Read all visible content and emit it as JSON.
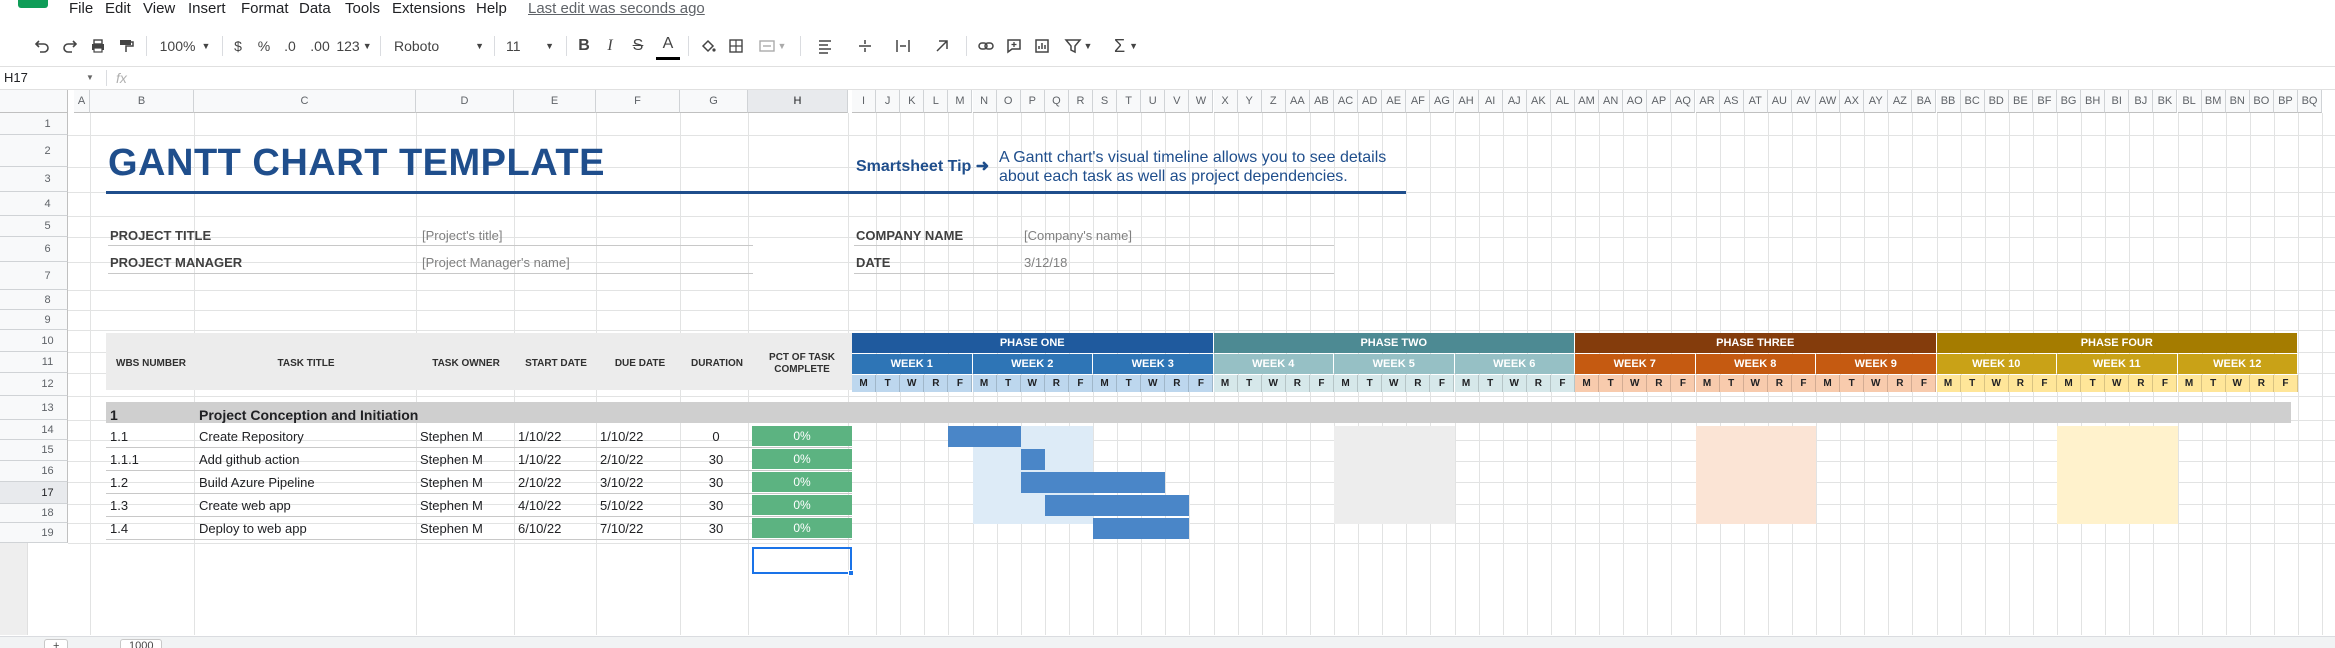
{
  "menu": {
    "items": [
      "File",
      "Edit",
      "View",
      "Insert",
      "Format",
      "Data",
      "Tools",
      "Extensions",
      "Help"
    ],
    "last_edit": "Last edit was seconds ago"
  },
  "toolbar": {
    "zoom": "100%",
    "currency": "$",
    "percent": "%",
    "decrease_decimal": ".0",
    "increase_decimal": ".00",
    "more_formats": "123",
    "font": "Roboto",
    "font_size": "11",
    "bold": "B",
    "italic": "I",
    "strike": "S",
    "text_color": "A"
  },
  "formula_bar": {
    "cell_ref": "H17",
    "fx": "fx",
    "value": ""
  },
  "columns": [
    "A",
    "B",
    "C",
    "D",
    "E",
    "F",
    "G",
    "H",
    "I",
    "J",
    "K",
    "L",
    "M",
    "N",
    "O",
    "P",
    "Q",
    "R",
    "S",
    "T",
    "U",
    "V",
    "W",
    "X",
    "Y",
    "Z",
    "AA",
    "AB",
    "AC",
    "AD",
    "AE",
    "AF",
    "AG",
    "AH",
    "AI",
    "AJ",
    "AK",
    "AL",
    "AM",
    "AN",
    "AO",
    "AP",
    "AQ",
    "AR",
    "AS",
    "AT",
    "AU",
    "AV",
    "AW",
    "AX",
    "AY",
    "AZ",
    "BA",
    "BB",
    "BC",
    "BD",
    "BE",
    "BF",
    "BG",
    "BH",
    "BI",
    "BJ",
    "BK",
    "BL",
    "BM",
    "BN",
    "BO",
    "BP",
    "BQ"
  ],
  "rows": [
    "1",
    "2",
    "3",
    "4",
    "5",
    "6",
    "7",
    "8",
    "9",
    "10",
    "11",
    "12",
    "13",
    "14",
    "15",
    "16",
    "17",
    "18",
    "19"
  ],
  "sheet": {
    "title": "GANTT CHART TEMPLATE",
    "tip_label": "Smartsheet Tip ➜",
    "tip_text": "A Gantt chart's visual timeline allows you to see details about each task as well as project dependencies.",
    "project_title_label": "PROJECT TITLE",
    "project_title_value": "[Project's title]",
    "project_manager_label": "PROJECT MANAGER",
    "project_manager_value": "[Project Manager's name]",
    "company_name_label": "COMPANY NAME",
    "company_name_value": "[Company's name]",
    "date_label": "DATE",
    "date_value": "3/12/18",
    "headers": {
      "wbs": "WBS NUMBER",
      "task": "TASK TITLE",
      "owner": "TASK OWNER",
      "start": "START DATE",
      "due": "DUE DATE",
      "duration": "DURATION",
      "pct": "PCT OF TASK COMPLETE"
    },
    "phases": [
      {
        "label": "PHASE ONE",
        "color": "#1f5a9e",
        "week_color": "#2e75b6",
        "day_color": "#bdd7ee",
        "shade_color": "#ddebf7"
      },
      {
        "label": "PHASE TWO",
        "color": "#4d8a93",
        "week_color": "#96c0c5",
        "day_color": "#d6e8ea",
        "shade_color": "#ededed"
      },
      {
        "label": "PHASE THREE",
        "color": "#843c0c",
        "week_color": "#c55a11",
        "day_color": "#f8cbad",
        "shade_color": "#fbe4d5"
      },
      {
        "label": "PHASE FOUR",
        "color": "#a57c00",
        "week_color": "#c9a217",
        "day_color": "#ffe699",
        "shade_color": "#fff2cc"
      }
    ],
    "weeks": [
      "WEEK 1",
      "WEEK 2",
      "WEEK 3",
      "WEEK 4",
      "WEEK 5",
      "WEEK 6",
      "WEEK 7",
      "WEEK 8",
      "WEEK 9",
      "WEEK 10",
      "WEEK 11",
      "WEEK 12"
    ],
    "days": [
      "M",
      "T",
      "W",
      "R",
      "F"
    ],
    "section": {
      "wbs": "1",
      "title": "Project Conception and Initiation"
    },
    "tasks": [
      {
        "wbs": "1.1",
        "title": "Create Repository",
        "owner": "Stephen M",
        "start": "1/10/22",
        "due": "1/10/22",
        "duration": "0",
        "pct": "0%",
        "bar_start": 4,
        "bar_len": 3
      },
      {
        "wbs": "1.1.1",
        "title": "Add github action",
        "owner": "Stephen M",
        "start": "1/10/22",
        "due": "2/10/22",
        "duration": "30",
        "pct": "0%",
        "bar_start": 7,
        "bar_len": 1
      },
      {
        "wbs": "1.2",
        "title": "Build Azure Pipeline",
        "owner": "Stephen M",
        "start": "2/10/22",
        "due": "3/10/22",
        "duration": "30",
        "pct": "0%",
        "bar_start": 7,
        "bar_len": 6
      },
      {
        "wbs": "1.3",
        "title": "Create web app",
        "owner": "Stephen M",
        "start": "4/10/22",
        "due": "5/10/22",
        "duration": "30",
        "pct": "0%",
        "bar_start": 8,
        "bar_len": 6
      },
      {
        "wbs": "1.4",
        "title": "Deploy to web app",
        "owner": "Stephen M",
        "start": "6/10/22",
        "due": "7/10/22",
        "duration": "30",
        "pct": "0%",
        "bar_start": 10,
        "bar_len": 4
      }
    ]
  },
  "sheet_tabs": {
    "add": "+",
    "current": "1000"
  },
  "colors": {
    "bar": "#4a86c8",
    "pct_fill": "#5cb381",
    "title": "#1f4e8c",
    "selection": "#1a73e8"
  }
}
